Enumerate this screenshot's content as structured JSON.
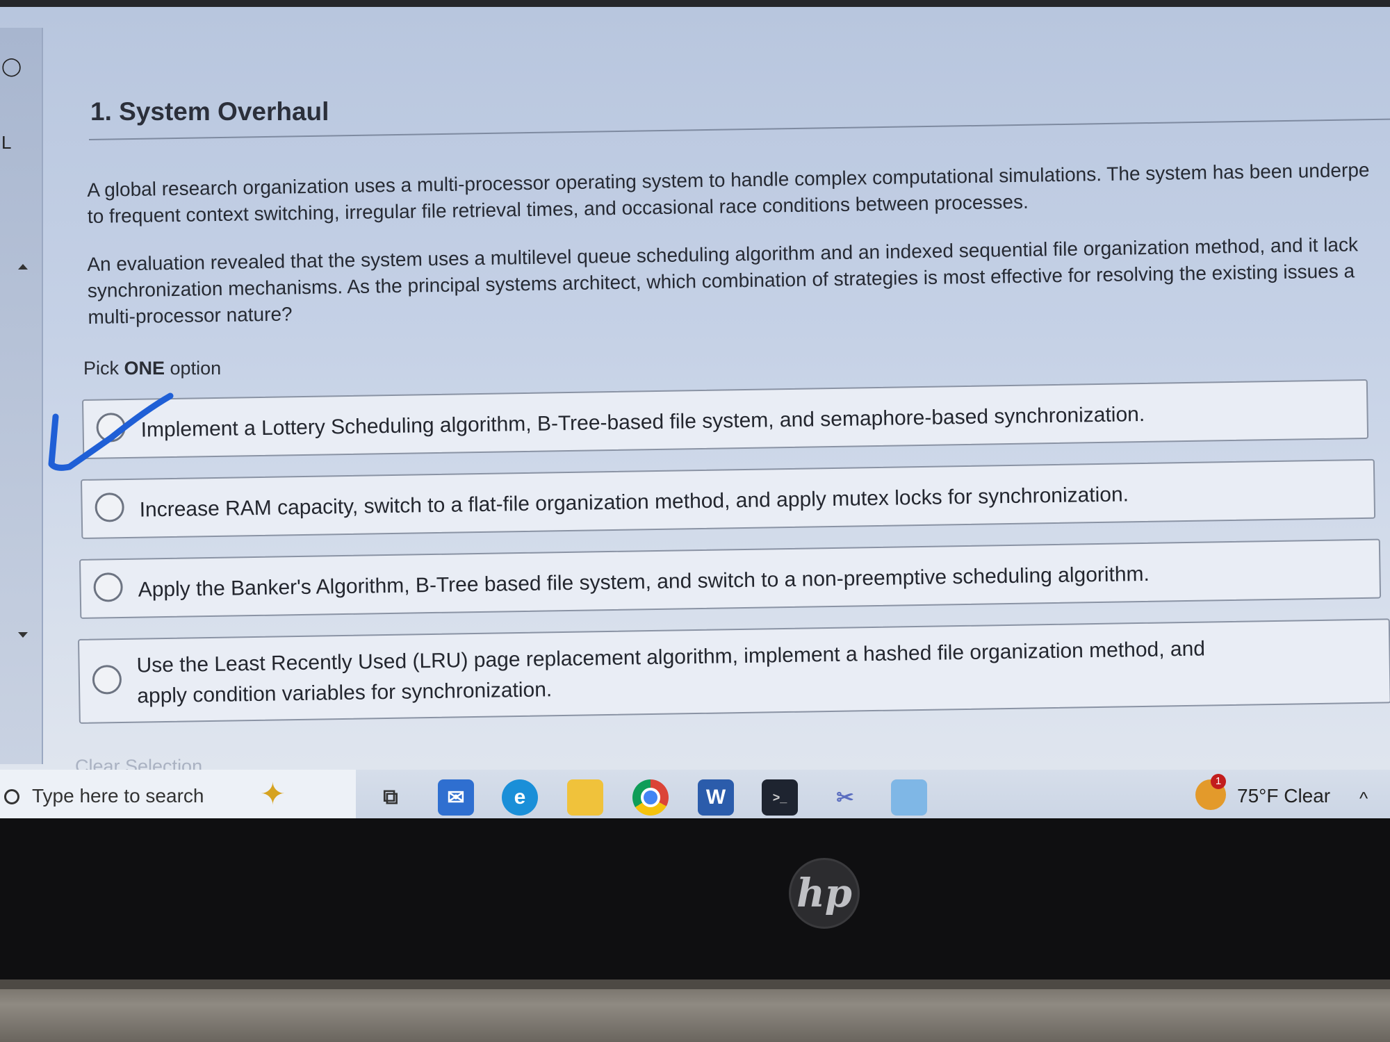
{
  "question": {
    "title": "1. System Overhaul",
    "paragraphs": [
      "A global research organization uses a multi-processor operating system to handle complex computational simulations. The system has been underpe",
      "to frequent context switching, irregular file retrieval times, and occasional race conditions between processes.",
      "An evaluation revealed that the system uses a multilevel queue scheduling algorithm and an indexed sequential file organization method, and it lack",
      "synchronization mechanisms. As the principal systems architect, which combination of strategies is most effective for resolving the existing issues a",
      "multi-processor nature?"
    ],
    "pick_prefix": "Pick ",
    "pick_bold": "ONE",
    "pick_suffix": " option",
    "options": [
      {
        "line1": "Implement a Lottery Scheduling algorithm, B-Tree-based file system, and semaphore-based synchronization.",
        "line2": ""
      },
      {
        "line1": "Increase RAM capacity, switch to a flat-file organization method, and apply mutex locks for synchronization.",
        "line2": ""
      },
      {
        "line1": "Apply the Banker's Algorithm, B-Tree based file system, and switch to a non-preemptive scheduling algorithm.",
        "line2": ""
      },
      {
        "line1": "Use the Least Recently Used (LRU) page replacement algorithm, implement a hashed file organization method, and",
        "line2": "apply condition variables for synchronization."
      }
    ],
    "clear_selection": "Clear Selection",
    "annotation_color": "#1f5fd6"
  },
  "taskbar": {
    "search_placeholder": "Type here to search",
    "icons": [
      "task-view-icon",
      "mail-icon",
      "edge-icon",
      "file-explorer-icon",
      "chrome-icon",
      "word-icon",
      "terminal-icon",
      "snipping-tool-icon",
      "notepad-icon"
    ],
    "word_letter": "W",
    "weather_badge": "1",
    "weather": "75°F  Clear",
    "tray_caret": "^"
  },
  "laptop": {
    "brand": "hp"
  }
}
